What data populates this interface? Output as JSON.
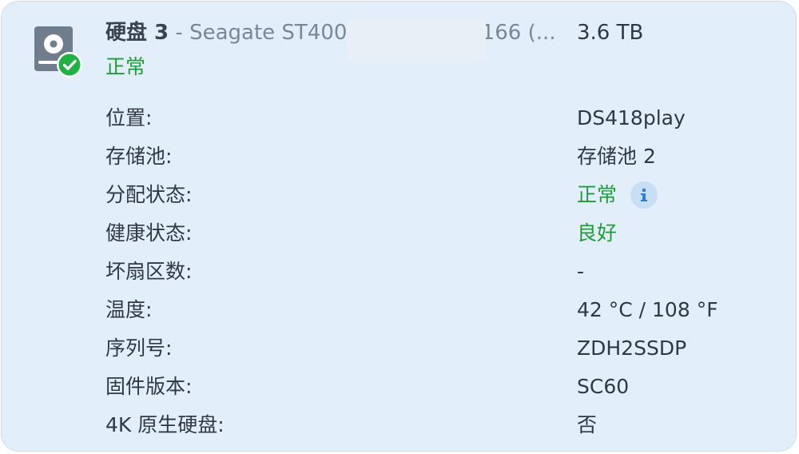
{
  "disk": {
    "title": "硬盘 3",
    "separator": " - ",
    "model": "Seagate ST400",
    "model_tail": ".166 (...",
    "capacity": "3.6 TB",
    "status": "正常",
    "status_color": "#1e9e3b",
    "icon": "hard-disk-healthy-icon"
  },
  "details": [
    {
      "label": "位置:",
      "value": "DS418play"
    },
    {
      "label": "存储池:",
      "value": "存储池 2"
    },
    {
      "label": "分配状态:",
      "value": "正常",
      "info_icon": "info-icon"
    },
    {
      "label": "健康状态:",
      "value": "良好"
    },
    {
      "label": "坏扇区数:",
      "value": "-"
    },
    {
      "label": "温度:",
      "value": "42 °C / 108 °F"
    },
    {
      "label": "序列号:",
      "value": "ZDH2SSDP"
    },
    {
      "label": "固件版本:",
      "value": "SC60"
    },
    {
      "label": "4K 原生硬盘:",
      "value": "否"
    }
  ]
}
